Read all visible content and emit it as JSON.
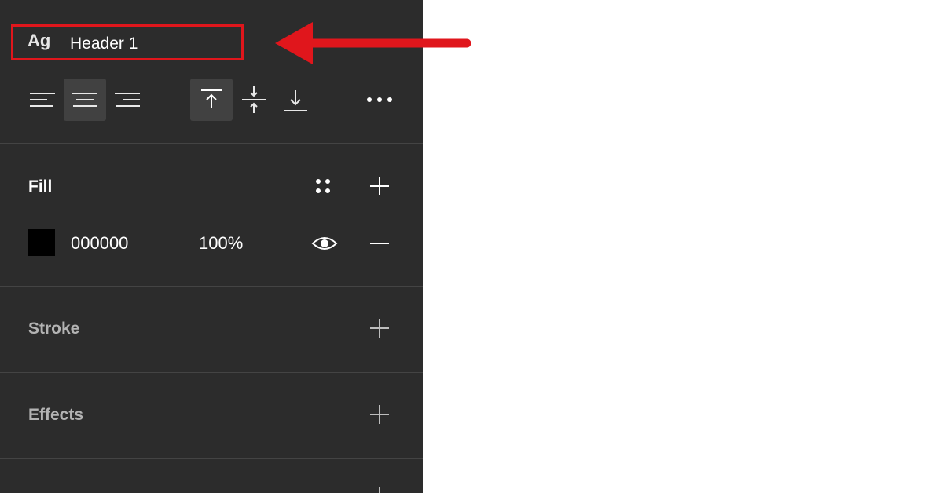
{
  "text_style": {
    "icon": "Ag",
    "name": "Header 1"
  },
  "toolbar": {
    "icons": [
      "align-left-icon",
      "align-center-icon",
      "align-right-icon",
      "align-top-icon",
      "align-middle-icon",
      "align-bottom-icon",
      "more-icon"
    ],
    "active": [
      "align-center-icon",
      "align-top-icon"
    ]
  },
  "fill": {
    "title": "Fill",
    "hex": "000000",
    "opacity": "100%",
    "swatch_color": "#000000",
    "icons": [
      "style-grid-icon",
      "add-icon",
      "eye-icon",
      "remove-icon"
    ]
  },
  "stroke": {
    "title": "Stroke"
  },
  "effects": {
    "title": "Effects"
  },
  "annotation": {
    "arrow_color": "#e0161c"
  }
}
